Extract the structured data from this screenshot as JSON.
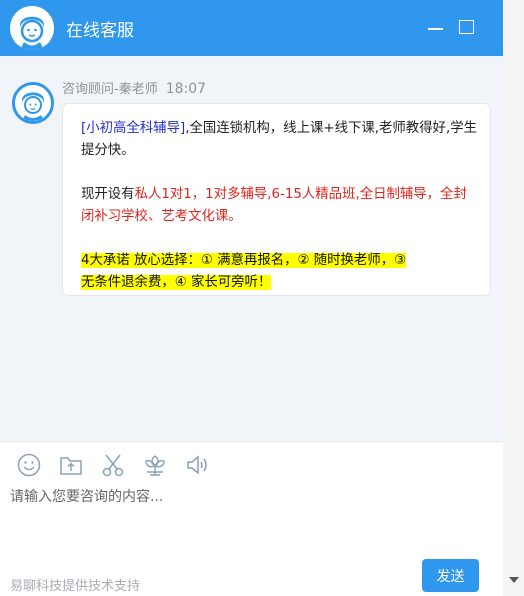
{
  "header": {
    "title": "在线客服",
    "avatar_icon": "agent-avatar-icon",
    "minimize_icon": "minimize-icon",
    "maximize_icon": "maximize-icon",
    "color": "#2f97ee"
  },
  "message": {
    "sender": "咨询顾问-秦老师",
    "time": "18:07",
    "p1_link": "[小初高全科辅导]",
    "p1_rest": ",全国连锁机构，线上课+线下课,老师教得好,学生提分快。",
    "p2_prefix": "现开设有",
    "p2_red": "私人1对1，1对多辅导,6-15人精品班,全日制辅导，全封闭补习学校、艺考文化课。",
    "p3_highlight_1": "4大承诺 放心选择：① 满意再报名，② 随时换老师，③",
    "p3_highlight_2": "无条件退余费，④ 家长可旁听！",
    "colors": {
      "link": "#2631c7",
      "red": "#e0251c",
      "highlight": "#ffff00"
    }
  },
  "toolbar": {
    "icons": [
      "emoji-icon",
      "upload-file-icon",
      "scissors-icon",
      "rate-flower-icon",
      "volume-icon"
    ]
  },
  "input": {
    "placeholder": "请输入您要咨询的内容..."
  },
  "footer": {
    "powered_by": "易聊科技提供技术支持",
    "send_label": "发送"
  }
}
